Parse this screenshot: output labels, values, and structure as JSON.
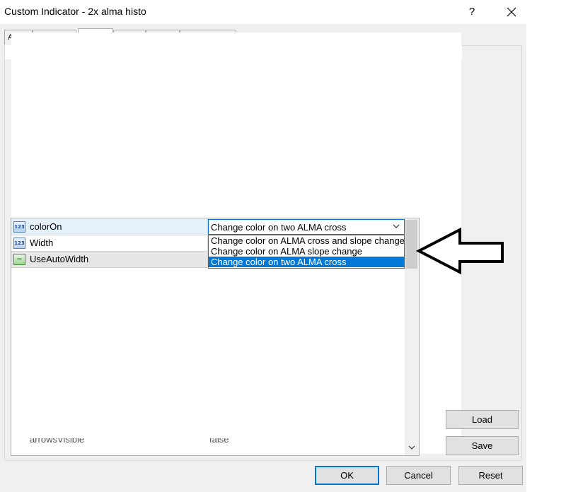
{
  "window": {
    "title": "Custom Indicator - 2x alma histo",
    "help_label": "?",
    "close_label": "✕"
  },
  "tabs": [
    {
      "label": "A"
    },
    {
      "label": ""
    },
    {
      "label": ""
    },
    {
      "label": ""
    },
    {
      "label": ""
    },
    {
      "label": ""
    },
    {
      "label": ""
    }
  ],
  "grid": {
    "rows": [
      {
        "name": "colorOn",
        "icon": "number-icon",
        "icon_text": "123"
      },
      {
        "name": "Width",
        "icon": "number-icon",
        "icon_text": "123"
      },
      {
        "name": "UseAutoWidth",
        "icon": "graph-icon",
        "icon_text": "~"
      }
    ],
    "cut_row": {
      "name": "arrowsVisible",
      "value": "false"
    }
  },
  "combo": {
    "value": "Change color on two ALMA cross",
    "options": [
      "Change color on ALMA cross and slope change",
      "Change color on ALMA slope change",
      "Change color on two ALMA cross"
    ],
    "selected_index": 2
  },
  "buttons": {
    "load": "Load",
    "save": "Save",
    "ok": "OK",
    "cancel": "Cancel",
    "reset": "Reset"
  },
  "colors": {
    "selection": "#0078d7",
    "dialog_bg": "#f0f0f0"
  }
}
